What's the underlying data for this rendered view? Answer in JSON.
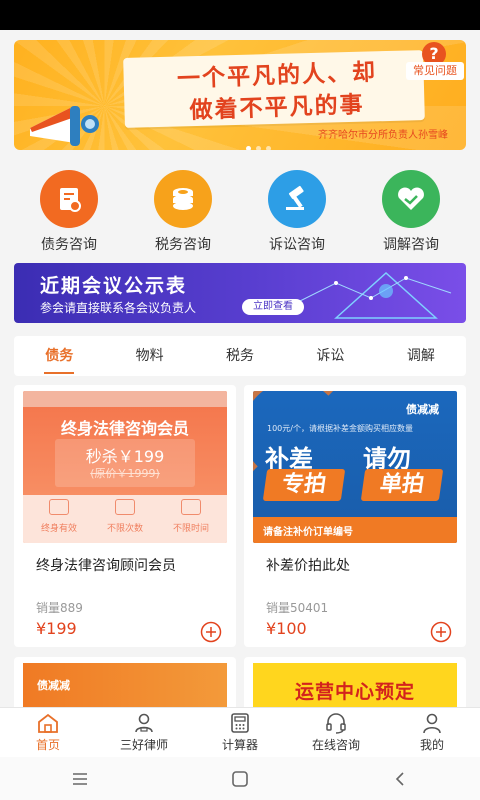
{
  "banner": {
    "line1": "一个平凡的人、却",
    "line2": "做着不平凡的事",
    "signature": "齐齐哈尔市分所负责人孙雪峰",
    "faq_label": "常见问题",
    "faq_icon": "question-icon"
  },
  "categories": [
    {
      "label": "债务咨询",
      "icon": "debt-document-icon",
      "color": "#f26a21"
    },
    {
      "label": "税务咨询",
      "icon": "coin-stack-icon",
      "color": "#f7a21b"
    },
    {
      "label": "诉讼咨询",
      "icon": "gavel-icon",
      "color": "#2d9ee6"
    },
    {
      "label": "调解咨询",
      "icon": "handshake-heart-icon",
      "color": "#3bb55b"
    }
  ],
  "meeting": {
    "title": "近期会议公示表",
    "subtitle": "参会请直接联系各会议负责人",
    "button": "立即查看"
  },
  "tabs": [
    {
      "label": "债务",
      "active": true
    },
    {
      "label": "物料",
      "active": false
    },
    {
      "label": "税务",
      "active": false
    },
    {
      "label": "诉讼",
      "active": false
    },
    {
      "label": "调解",
      "active": false
    }
  ],
  "products": [
    {
      "name": "终身法律咨询顾问会员",
      "sales": "销量889",
      "price": "¥199",
      "image": {
        "title": "终身法律咨询会员",
        "flash": "秒杀￥199",
        "original": "(原价￥1999)",
        "features": [
          "终身有效",
          "不限次数",
          "不限时间"
        ]
      }
    },
    {
      "name": "补差价拍此处",
      "sales": "销量50401",
      "price": "¥100",
      "image": {
        "logo": "债减减",
        "note": "100元/个，请根据补差金额购买相应数量",
        "w1": "补差",
        "w2": "请勿",
        "w3": "专拍",
        "w4": "单拍",
        "stripe": "请备注补价订单编号"
      }
    },
    {
      "image": {
        "logo": "债减减"
      }
    },
    {
      "image": {
        "text": "运营中心预定"
      }
    }
  ],
  "bottom_nav": [
    {
      "label": "首页",
      "icon": "home-icon",
      "active": true
    },
    {
      "label": "三好律师",
      "icon": "lawyer-icon",
      "active": false
    },
    {
      "label": "计算器",
      "icon": "calculator-icon",
      "active": false
    },
    {
      "label": "在线咨询",
      "icon": "headset-icon",
      "active": false
    },
    {
      "label": "我的",
      "icon": "user-icon",
      "active": false
    }
  ],
  "system_nav": [
    "menu-icon",
    "home-square-icon",
    "back-icon"
  ],
  "colors": {
    "accent": "#e8702a",
    "price": "#e2431e",
    "banner": "#ffb11f",
    "meeting": "#4a33c4"
  }
}
